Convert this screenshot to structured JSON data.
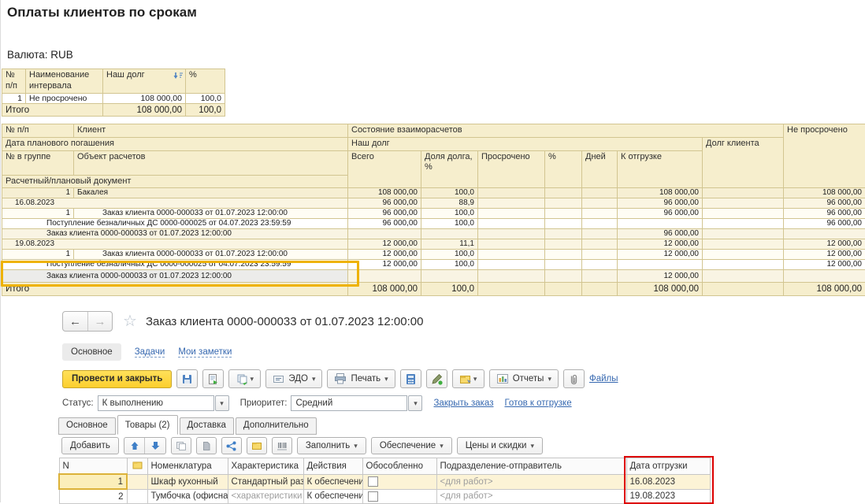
{
  "colors": {
    "accent_yellow": "#fccf2e",
    "annotation_red": "#dd0000",
    "selection_orange": "#eeb200",
    "link_blue": "#3668b0",
    "overdue_red": "#b00000",
    "table_header_bg": "#f6eecd"
  },
  "report": {
    "title": "Оплаты клиентов по срокам",
    "currency": "Валюта: RUB",
    "summary_table": {
      "headers": {
        "num": "№ п/п",
        "interval": "Наименование интервала",
        "our_debt": "Наш долг",
        "percent": "%"
      },
      "sort_icon": "sort-descending-icon",
      "row": {
        "num": "1",
        "interval": "Не просрочено",
        "our_debt": "108 000,00",
        "percent": "100,0"
      },
      "total": {
        "label": "Итого",
        "our_debt": "108 000,00",
        "percent": "100,0"
      }
    },
    "detail_table": {
      "headers": {
        "num": "№ п/п",
        "client": "Клиент",
        "settlement_state": "Состояние взаиморасчетов",
        "not_overdue": "Не просрочено",
        "planned_date": "Дата планового погашения",
        "our_debt": "Наш долг",
        "client_debt": "Долг клиента",
        "num_in_group": "№ в группе",
        "settlement_object": "Объект расчетов",
        "total": "Всего",
        "debt_share": "Доля долга, %",
        "overdue": "Просрочено",
        "overdue_pct": "%",
        "days": "Дней",
        "to_ship": "К отгрузке",
        "document": "Расчетный/плановый документ"
      },
      "rows": [
        {
          "style": "group",
          "num": "1",
          "label": "Бакалея",
          "total": "108 000,00",
          "share": "100,0",
          "to_ship": "108 000,00",
          "not_overdue": "108 000,00"
        },
        {
          "style": "date",
          "label": "16.08.2023",
          "total": "96 000,00",
          "share": "88,9",
          "to_ship": "96 000,00",
          "not_overdue": "96 000,00"
        },
        {
          "style": "order",
          "num": "1",
          "label": "Заказ клиента 0000-000033 от 01.07.2023 12:00:00",
          "total": "96 000,00",
          "share": "100,0",
          "to_ship": "96 000,00",
          "not_overdue": "96 000,00"
        },
        {
          "style": "doc",
          "label": "Поступление безналичных ДС 0000-000025 от 04.07.2023 23:59:59",
          "total": "96 000,00",
          "share": "100,0",
          "not_overdue": "96 000,00"
        },
        {
          "style": "doc2",
          "label": "Заказ клиента 0000-000033 от 01.07.2023 12:00:00",
          "to_ship": "96 000,00"
        },
        {
          "style": "date",
          "label": "19.08.2023",
          "total": "12 000,00",
          "share": "11,1",
          "to_ship": "12 000,00",
          "not_overdue": "12 000,00"
        },
        {
          "style": "order",
          "num": "1",
          "label": "Заказ клиента 0000-000033 от 01.07.2023 12:00:00",
          "total": "12 000,00",
          "share": "100,0",
          "to_ship": "12 000,00",
          "not_overdue": "12 000,00"
        },
        {
          "style": "doc",
          "label": "Поступление безналичных ДС 0000-000025 от 04.07.2023 23:59:59",
          "total": "12 000,00",
          "share": "100,0",
          "not_overdue": "12 000,00"
        },
        {
          "style": "highlight",
          "label": "Заказ клиента 0000-000033 от 01.07.2023 12:00:00",
          "to_ship": "12 000,00"
        }
      ],
      "total_row": {
        "label": "Итого",
        "total": "108 000,00",
        "share": "100,0",
        "to_ship": "108 000,00",
        "not_overdue": "108 000,00"
      }
    }
  },
  "order_form": {
    "title": "Заказ клиента 0000-000033 от 01.07.2023 12:00:00",
    "section_tabs": [
      {
        "label": "Основное",
        "active": true
      },
      {
        "label": "Задачи",
        "active": false
      },
      {
        "label": "Мои заметки",
        "active": false
      }
    ],
    "toolbar": {
      "post_close": "Провести и закрыть",
      "edo": "ЭДО",
      "print": "Печать",
      "reports": "Отчеты",
      "files": "Файлы"
    },
    "status_row": {
      "status_label": "Статус:",
      "status_value": "К выполнению",
      "priority_label": "Приоритет:",
      "priority_value": "Средний",
      "close_order_link": "Закрыть заказ",
      "ready_link": "Готов к отгрузке"
    },
    "doc_tabs": [
      {
        "label": "Основное",
        "active": false
      },
      {
        "label": "Товары (2)",
        "active": true
      },
      {
        "label": "Доставка",
        "active": false
      },
      {
        "label": "Дополнительно",
        "active": false
      }
    ],
    "items_toolbar": {
      "add": "Добавить",
      "fill": "Заполнить",
      "supply": "Обеспечение",
      "prices": "Цены и скидки"
    },
    "items_table": {
      "headers": [
        "N",
        "",
        "Номенклатура",
        "Характеристика",
        "Действия",
        "Обособленно",
        "Подразделение-отправитель",
        "Дата отгрузки"
      ],
      "rows": [
        {
          "n": "1",
          "nomenclature": "Шкаф кухонный",
          "characteristic": "Стандартный размер",
          "action": "К обеспечению",
          "separate": false,
          "department": "<для работ>",
          "ship_date": "16.08.2023",
          "selected": true
        },
        {
          "n": "2",
          "nomenclature": "Тумбочка (офисная меб...",
          "characteristic": "<характеристики не исп...",
          "action": "К обеспечению",
          "separate": false,
          "department": "<для работ>",
          "ship_date": "19.08.2023",
          "selected": false
        }
      ]
    }
  }
}
